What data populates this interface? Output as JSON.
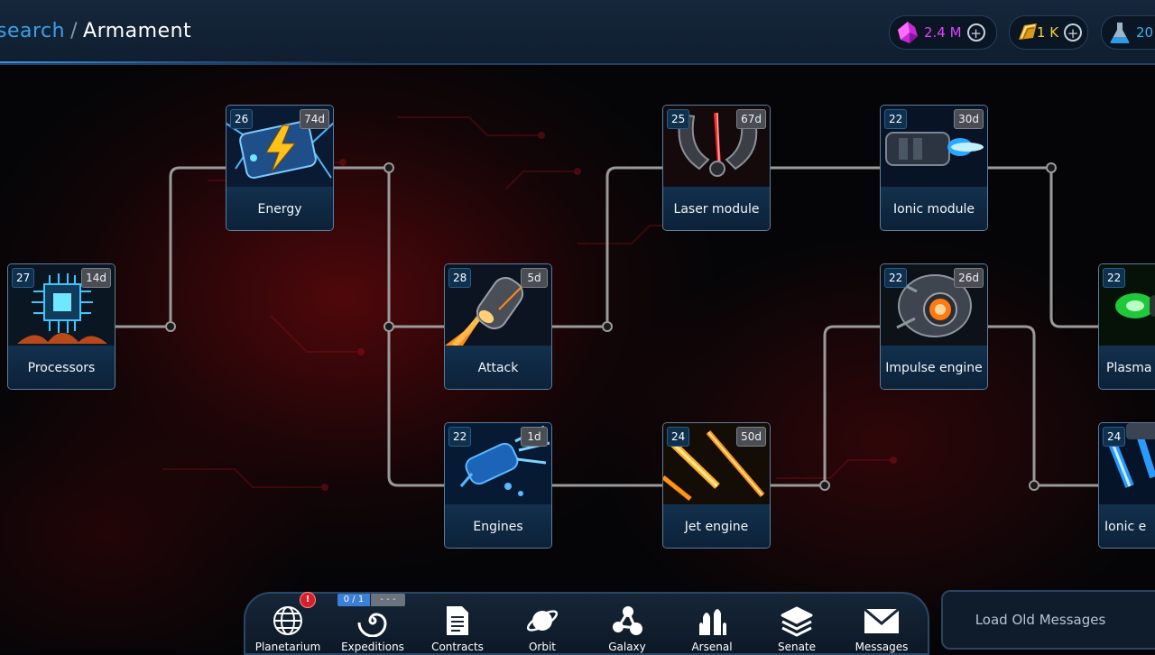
{
  "header": {
    "breadcrumb_parent": "search",
    "breadcrumb_sep": "/",
    "breadcrumb_current": "Armament"
  },
  "resources": [
    {
      "name": "crystal-icon",
      "value": "2.4 M",
      "color": "#e040ff",
      "plus": "+"
    },
    {
      "name": "gold-icon",
      "value": "1 K",
      "color": "#f6d02a",
      "plus": "+"
    },
    {
      "name": "flask-icon",
      "value": "20",
      "color": "#3ab0f0"
    }
  ],
  "tree": {
    "nodes": [
      {
        "id": "processors",
        "label": "Processors",
        "level": "27",
        "duration": "14d"
      },
      {
        "id": "energy",
        "label": "Energy",
        "level": "26",
        "duration": "74d"
      },
      {
        "id": "attack",
        "label": "Attack",
        "level": "28",
        "duration": "5d"
      },
      {
        "id": "engines",
        "label": "Engines",
        "level": "22",
        "duration": "1d"
      },
      {
        "id": "laser",
        "label": "Laser module",
        "level": "25",
        "duration": "67d"
      },
      {
        "id": "jet",
        "label": "Jet engine",
        "level": "24",
        "duration": "50d"
      },
      {
        "id": "ionic",
        "label": "Ionic module",
        "level": "22",
        "duration": "30d"
      },
      {
        "id": "impulse",
        "label": "Impulse engine",
        "level": "22",
        "duration": "26d"
      },
      {
        "id": "plasma",
        "label": "Plasma m",
        "level": "22"
      },
      {
        "id": "ionic-engine",
        "label": "Ionic e",
        "level": "24"
      }
    ]
  },
  "nav": {
    "items": [
      {
        "id": "planetarium",
        "label": "Planetarium",
        "icon": "globe-icon"
      },
      {
        "id": "expeditions",
        "label": "Expeditions",
        "icon": "spiral-icon"
      },
      {
        "id": "contracts",
        "label": "Contracts",
        "icon": "document-icon"
      },
      {
        "id": "orbit",
        "label": "Orbit",
        "icon": "planet-icon"
      },
      {
        "id": "galaxy",
        "label": "Galaxy",
        "icon": "galaxy-icon"
      },
      {
        "id": "arsenal",
        "label": "Arsenal",
        "icon": "rockets-icon"
      },
      {
        "id": "senate",
        "label": "Senate",
        "icon": "layers-icon"
      },
      {
        "id": "messages",
        "label": "Messages",
        "icon": "envelope-icon"
      }
    ],
    "planetarium_alert": "!",
    "expeditions_counter": "0 / 1",
    "expeditions_status": "- - -"
  },
  "messages": {
    "load_old_label": "Load Old Messages"
  },
  "colors": {
    "accent": "#3aa0e8",
    "connector": "#9a9a9a",
    "node_bg": "#0e2740"
  }
}
